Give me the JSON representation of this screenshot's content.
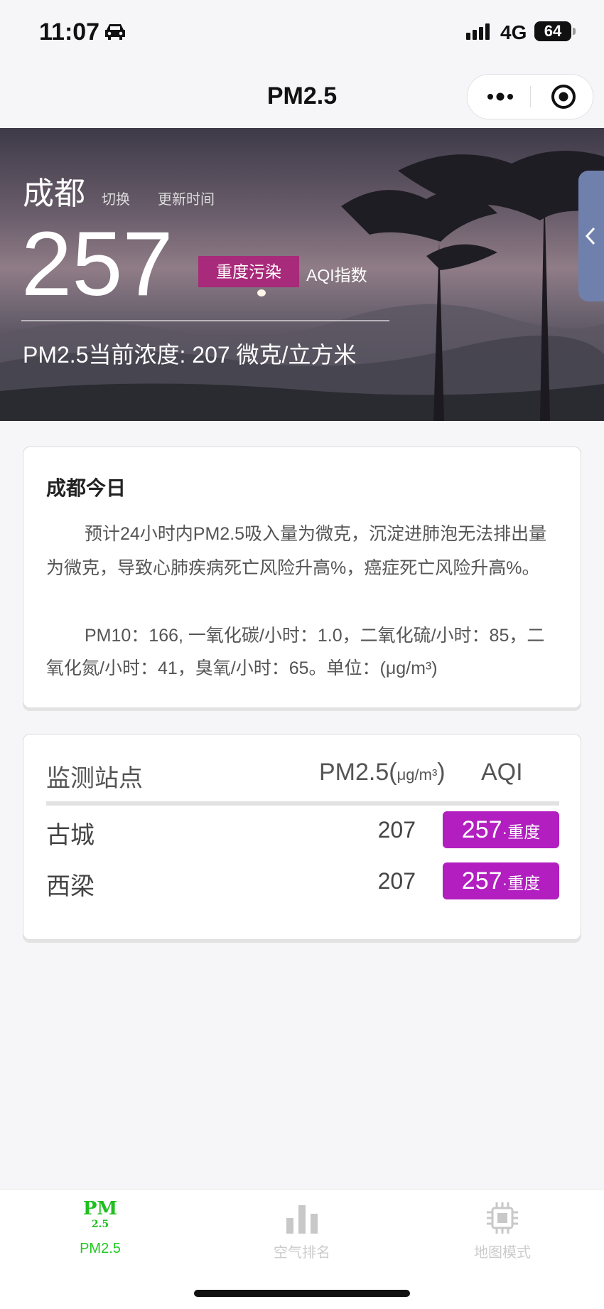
{
  "status_bar": {
    "time": "11:07",
    "network": "4G",
    "battery": "64"
  },
  "nav": {
    "title": "PM2.5"
  },
  "hero": {
    "city": "成都",
    "switch_label": "切换",
    "update_label": "更新时间",
    "aqi": "257",
    "level": "重度污染",
    "aqi_label": "AQI指数",
    "concentration": "PM2.5当前浓度: 207 微克/立方米"
  },
  "today": {
    "title": "成都今日",
    "paragraph1": "预计24小时内PM2.5吸入量为微克，沉淀进肺泡无法排出量为微克，导致心肺疾病死亡风险升高%，癌症死亡风险升高%。",
    "paragraph2": "PM10：166, 一氧化碳/小时：1.0，二氧化硫/小时：85，二氧化氮/小时：41，臭氧/小时：65。单位：(μg/m³)"
  },
  "stations": {
    "headers": {
      "station": "监测站点",
      "pm": "PM2.5(",
      "pm_unit": "μg/m³",
      "pm_close": ")",
      "aqi": "AQI"
    },
    "rows": [
      {
        "name": "古城",
        "pm": "207",
        "aqi": "257",
        "level": "·重度"
      },
      {
        "name": "西梁",
        "pm": "207",
        "aqi": "257",
        "level": "·重度"
      }
    ]
  },
  "tabbar": {
    "items": [
      {
        "label": "PM2.5",
        "icon": "pm25-logo-icon",
        "logo_top": "PM",
        "logo_bottom": "2.5",
        "active": true
      },
      {
        "label": "空气排名",
        "icon": "bar-chart-icon",
        "active": false
      },
      {
        "label": "地图模式",
        "icon": "chip-icon",
        "active": false
      }
    ]
  },
  "colors": {
    "accent_green": "#22c822",
    "badge_purple": "#b21ec0",
    "level_badge": "#a82a7a"
  }
}
